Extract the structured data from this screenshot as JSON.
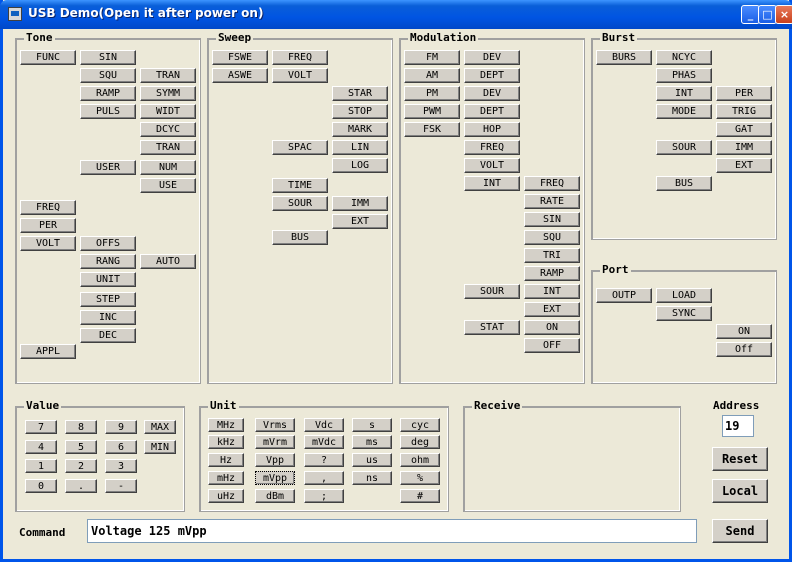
{
  "window": {
    "title": "USB Demo(Open it after power on)"
  },
  "groups": {
    "tone": "Tone",
    "sweep": "Sweep",
    "modulation": "Modulation",
    "burst": "Burst",
    "port": "Port",
    "value": "Value",
    "unit": "Unit",
    "receive": "Receive"
  },
  "tone": {
    "FUNC": "FUNC",
    "SIN": "SIN",
    "SQU": "SQU",
    "TRAN1": "TRAN",
    "RAMP": "RAMP",
    "SYMM": "SYMM",
    "PULS": "PULS",
    "WIDT": "WIDT",
    "DCYC": "DCYC",
    "TRAN2": "TRAN",
    "USER": "USER",
    "NUM": "NUM",
    "USE": "USE",
    "FREQ": "FREQ",
    "PER": "PER",
    "VOLT": "VOLT",
    "OFFS": "OFFS",
    "RANG": "RANG",
    "AUTO": "AUTO",
    "UNIT": "UNIT",
    "STEP": "STEP",
    "INC": "INC",
    "DEC": "DEC",
    "APPL": "APPL"
  },
  "sweep": {
    "FSWE": "FSWE",
    "FREQ": "FREQ",
    "ASWE": "ASWE",
    "VOLT": "VOLT",
    "STAR": "STAR",
    "STOP": "STOP",
    "MARK": "MARK",
    "SPAC": "SPAC",
    "LIN": "LIN",
    "LOG": "LOG",
    "TIME": "TIME",
    "SOUR": "SOUR",
    "IMM": "IMM",
    "EXT": "EXT",
    "BUS": "BUS"
  },
  "modulation": {
    "FM": "FM",
    "DEV1": "DEV",
    "AM": "AM",
    "DEPT1": "DEPT",
    "PM": "PM",
    "DEV2": "DEV",
    "PWM": "PWM",
    "DEPT2": "DEPT",
    "FSK": "FSK",
    "HOP": "HOP",
    "FREQ": "FREQ",
    "VOLT": "VOLT",
    "INT": "INT",
    "FREQ2": "FREQ",
    "RATE": "RATE",
    "SIN": "SIN",
    "SQU": "SQU",
    "TRI": "TRI",
    "RAMP": "RAMP",
    "SOUR": "SOUR",
    "INT2": "INT",
    "EXT": "EXT",
    "STAT": "STAT",
    "ON": "ON",
    "OFF": "OFF"
  },
  "burst": {
    "BURS": "BURS",
    "NCYC": "NCYC",
    "PHAS": "PHAS",
    "INT": "INT",
    "PER": "PER",
    "MODE": "MODE",
    "TRIG": "TRIG",
    "GAT": "GAT",
    "SOUR": "SOUR",
    "IMM": "IMM",
    "EXT": "EXT",
    "BUS": "BUS"
  },
  "port": {
    "OUTP": "OUTP",
    "LOAD": "LOAD",
    "SYNC": "SYNC",
    "ON": "ON",
    "Off": "Off"
  },
  "value": {
    "k7": "7",
    "k8": "8",
    "k9": "9",
    "MAX": "MAX",
    "k4": "4",
    "k5": "5",
    "k6": "6",
    "MIN": "MIN",
    "k1": "1",
    "k2": "2",
    "k3": "3",
    "k0": "0",
    "dot": ".",
    "minus": "-"
  },
  "unit": {
    "MHz": "MHz",
    "Vrms": "Vrms",
    "Vdc": "Vdc",
    "s": "s",
    "cyc": "cyc",
    "kHz": "kHz",
    "mVrm": "mVrm",
    "mVdc": "mVdc",
    "ms": "ms",
    "deg": "deg",
    "Hz": "Hz",
    "Vpp": "Vpp",
    "q": "?",
    "us": "us",
    "ohm": "ohm",
    "mHz": "mHz",
    "mVpp": "mVpp",
    "comma": ",",
    "ns": "ns",
    "pct": "%",
    "uHz": "uHz",
    "dBm": "dBm",
    "semi": ";",
    "hash": "#"
  },
  "address": {
    "label": "Address",
    "value": "19"
  },
  "buttons": {
    "reset": "Reset",
    "local": "Local",
    "send": "Send"
  },
  "command": {
    "label": "Command",
    "value": "Voltage 125 mVpp"
  }
}
